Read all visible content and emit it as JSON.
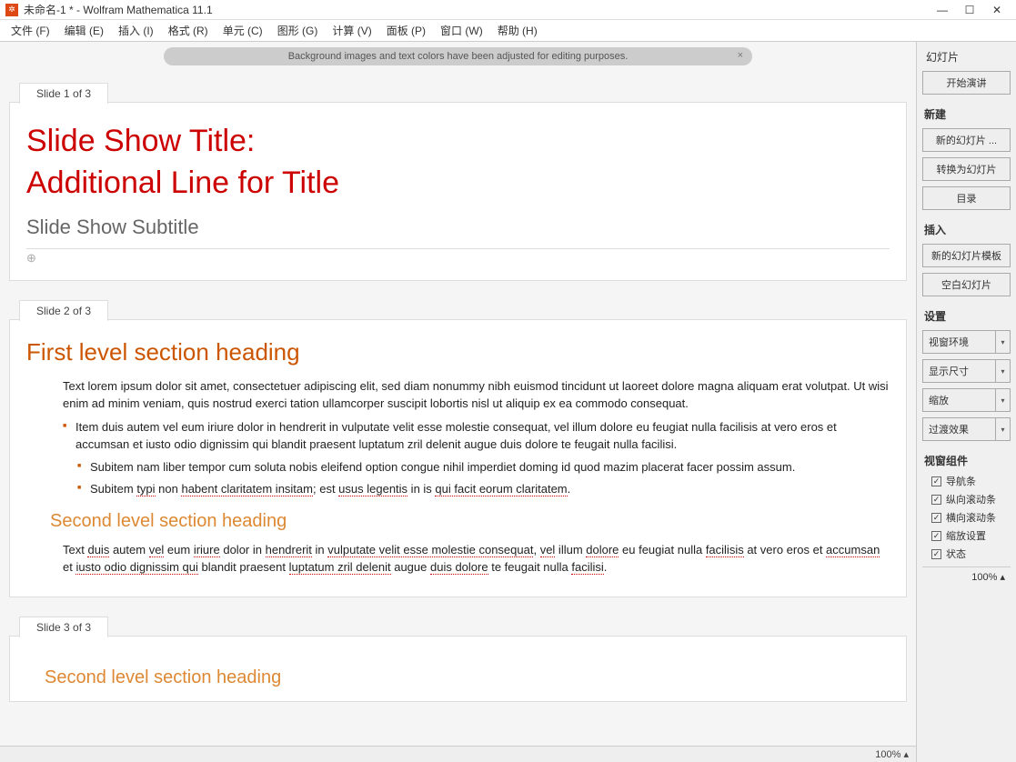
{
  "titlebar": {
    "title": "未命名-1 * - Wolfram Mathematica 11.1"
  },
  "menu": {
    "file": "文件 (F)",
    "edit": "编辑 (E)",
    "insert": "插入 (I)",
    "format": "格式 (R)",
    "cell": "单元 (C)",
    "graphics": "图形 (G)",
    "evaluation": "计算 (V)",
    "palettes": "面板 (P)",
    "window": "窗口 (W)",
    "help": "帮助 (H)"
  },
  "banner": {
    "text": "Background images and text colors have been adjusted for editing purposes.",
    "close": "×"
  },
  "slides": [
    {
      "tab": "Slide 1 of 3",
      "title_line1": "Slide Show Title:",
      "title_line2": "Additional Line for Title",
      "subtitle": "Slide Show Subtitle",
      "add_indicator": "⊕"
    },
    {
      "tab": "Slide 2 of 3",
      "h1": "First level section heading",
      "para1": "Text lorem ipsum dolor sit amet, consectetuer adipiscing elit, sed diam nonummy nibh euismod tincidunt ut laoreet dolore magna aliquam erat volutpat. Ut wisi enim ad minim veniam, quis nostrud exerci tation ullamcorper suscipit lobortis nisl ut aliquip ex ea commodo consequat.",
      "bullet1": "Item duis autem vel eum iriure dolor in hendrerit in vulputate velit esse molestie consequat, vel illum dolore eu feugiat nulla facilisis at vero eros et accumsan et iusto odio dignissim qui blandit praesent luptatum zril delenit augue duis dolore te feugait nulla facilisi.",
      "sub1": "Subitem nam liber tempor cum soluta nobis eleifend option congue nihil imperdiet doming id quod mazim placerat facer possim assum.",
      "sub2_a": "Subitem ",
      "sub2_b": "typi",
      "sub2_c": " non ",
      "sub2_d": "habent claritatem insitam",
      "sub2_e": "; est ",
      "sub2_f": "usus legentis",
      "sub2_g": " in is ",
      "sub2_h": "qui facit eorum claritatem",
      "sub2_i": ".",
      "h2": "Second level section heading",
      "para2_a": "Text ",
      "para2_b": "duis",
      "para2_c": " autem ",
      "para2_d": "vel",
      "para2_e": " eum ",
      "para2_f": "iriure",
      "para2_g": " dolor in ",
      "para2_h": "hendrerit",
      "para2_i": " in ",
      "para2_j": "vulputate velit esse molestie consequat",
      "para2_k": ", ",
      "para2_l": "vel",
      "para2_m": " illum ",
      "para2_n": "dolore",
      "para2_o": " eu feugiat nulla ",
      "para2_p": "facilisis",
      "para2_q": " at vero eros et ",
      "para2_r": "accumsan",
      "para2_s": " et ",
      "para2_t": "iusto odio dignissim qui",
      "para2_u": " blandit praesent ",
      "para2_v": "luptatum zril delenit",
      "para2_w": " augue ",
      "para2_x": "duis dolore",
      "para2_y": " te feugait nulla ",
      "para2_z": "facilisi",
      "para2_end": "."
    },
    {
      "tab": "Slide 3 of 3",
      "h2": "Second level section heading"
    }
  ],
  "sidebar": {
    "title": "幻灯片",
    "start": "开始演讲",
    "sec_new": "新建",
    "btn_new_slide": "新的幻灯片 ...",
    "btn_convert": "转换为幻灯片",
    "btn_toc": "目录",
    "sec_insert": "插入",
    "btn_template": "新的幻灯片模板",
    "btn_blank": "空白幻灯片",
    "sec_settings": "设置",
    "dd_viewenv": "视窗环境",
    "dd_dispsize": "显示尺寸",
    "dd_zoom": "缩放",
    "dd_transition": "过渡效果",
    "sec_components": "视窗组件",
    "chk_nav": "导航条",
    "chk_vscroll": "纵向滚动条",
    "chk_hscroll": "横向滚动条",
    "chk_zoomset": "缩放设置",
    "chk_status": "状态",
    "zoom": "100% ▴"
  },
  "status": {
    "zoom": "100% ▴"
  }
}
